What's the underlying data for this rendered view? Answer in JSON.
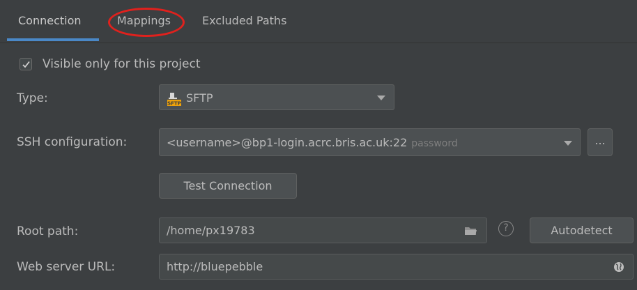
{
  "tabs": [
    {
      "label": "Connection",
      "active": true
    },
    {
      "label": "Mappings",
      "active": false
    },
    {
      "label": "Excluded Paths",
      "active": false
    }
  ],
  "visible_only": {
    "label": "Visible only for this project",
    "checked": true
  },
  "type": {
    "label": "Type:",
    "value": "SFTP",
    "icon": "sftp-icon"
  },
  "ssh": {
    "label": "SSH configuration:",
    "value": "<username>@bp1-login.acrc.bris.ac.uk:22",
    "hint": "password",
    "browse_label": "..."
  },
  "test_connection": {
    "label": "Test Connection"
  },
  "root_path": {
    "label": "Root path:",
    "value": "/home/px19783",
    "help": "?",
    "autodetect_label": "Autodetect"
  },
  "web_server": {
    "label": "Web server URL:",
    "value": "http://bluepebble"
  },
  "colors": {
    "accent": "#4a88c7",
    "annotation": "#e0211d",
    "background": "#3c3f41"
  }
}
